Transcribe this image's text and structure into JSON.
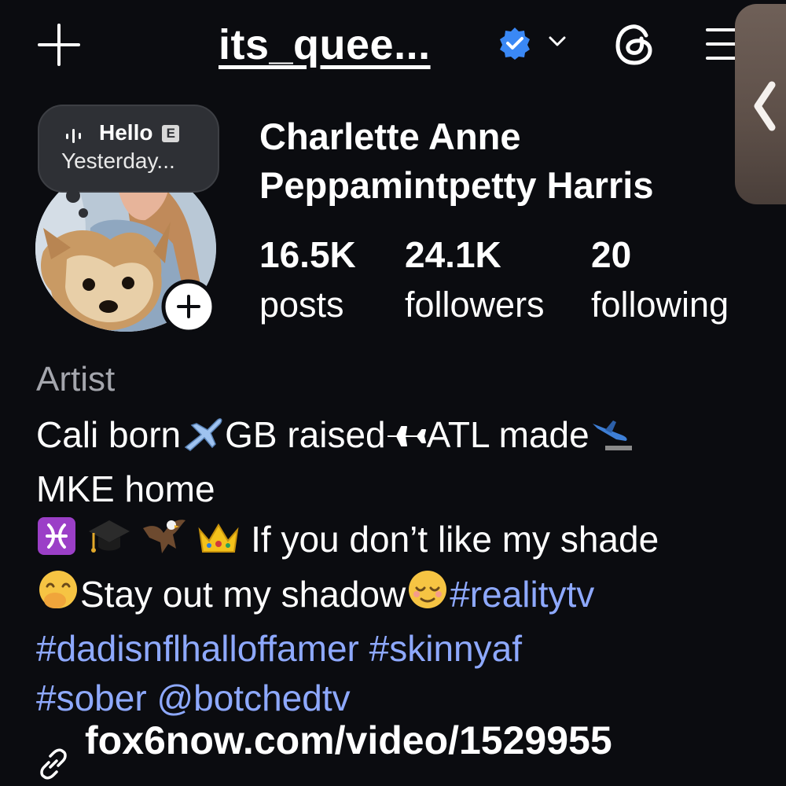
{
  "header": {
    "username": "its_quee...",
    "icons": [
      "plus-icon",
      "verified-badge-icon",
      "chevron-down-icon",
      "threads-icon",
      "menu-icon"
    ]
  },
  "note": {
    "line1": "Hello",
    "badge": "E",
    "line2": "Yesterday..."
  },
  "profile": {
    "name_line1": "Charlette Anne",
    "name_line2": "Peppamintpetty Harris"
  },
  "stats": [
    {
      "value": "16.5K",
      "label": "posts"
    },
    {
      "value": "24.1K",
      "label": "followers"
    },
    {
      "value": "20",
      "label": "following"
    }
  ],
  "bio": {
    "category": "Artist",
    "line1_a": "Cali born",
    "line1_b": "GB raised",
    "line1_c": "ATL made",
    "line2": "MKE home",
    "line3_text": " If you don’t like my shade",
    "line4_text": "Stay out my shadow",
    "tag_realitytv": "#realitytv",
    "tag_dad": "#dadisnflhalloffamer",
    "tag_skinny": "#skinnyaf",
    "tag_sober": "#sober",
    "mention": "@botchedtv"
  },
  "link": {
    "text": "fox6now.com/video/1529955"
  },
  "colors": {
    "background": "#0b0c10",
    "hashtag": "#8ea9ff",
    "verified": "#3a88f5",
    "category": "#a4a6ad"
  }
}
